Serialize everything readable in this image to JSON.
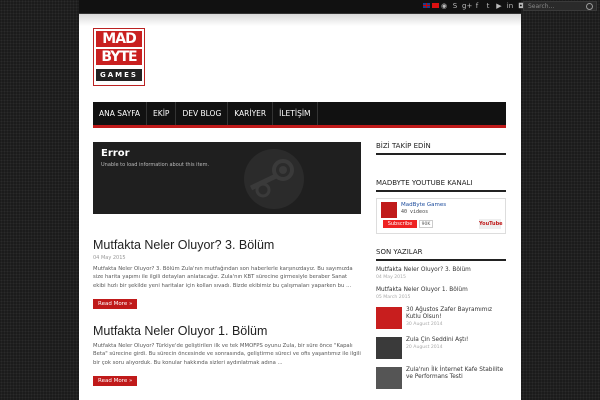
{
  "topbar": {
    "flags": [
      "uk",
      "tr"
    ],
    "social_icons": [
      "rss-icon",
      "skype-icon",
      "google-plus-icon",
      "facebook-icon",
      "twitter-icon",
      "youtube-icon",
      "linkedin-icon",
      "instagram-icon",
      "email-icon"
    ],
    "search_placeholder": "Search..."
  },
  "logo": {
    "line1": "MAD",
    "line2": "BYTE",
    "line3": "GAMES"
  },
  "nav": [
    "ANA SAYFA",
    "EKİP",
    "DEV BLOG",
    "KARİYER",
    "İLETİŞİM"
  ],
  "steam_widget": {
    "title": "Error",
    "message": "Unable to load information about this item."
  },
  "posts": [
    {
      "title": "Mutfakta Neler Oluyor? 3. Bölüm",
      "date": "04 May 2015",
      "excerpt": "Mutfakta Neler Oluyor? 3. Bölüm Zula'nın mutfağından son haberlerle karşınızdayız. Bu sayımızda size harita yapımı ile ilgili detayları anlatacağız. Zula'nın KBT sürecine girmesiyle beraber Sanat ekibi hızlı bir şekilde yeni haritalar için kollan sıvadı. Bizde ekibimiz bu çalışmaları yaparken bu ...",
      "more": "Read More »"
    },
    {
      "title": "Mutfakta Neler Oluyor 1. Bölüm",
      "date": "",
      "excerpt": "Mutfakta Neler Oluyor? Türkiye'de geliştirilen ilk ve tek MMOFPS oyunu Zula, bir süre önce \"Kapalı Beta\" sürecine girdi. Bu sürecin öncesinde ve sonrasında, geliştirme süreci ve ofis yaşantımız ile ilgili bir çok soru alıyorduk. Bu konular hakkında sizleri aydınlatmak adına ...",
      "more": "Read More »"
    }
  ],
  "sidebar": {
    "follow_title": "BİZİ TAKİP EDİN",
    "youtube_title": "MADBYTE YOUTUBE KANALI",
    "youtube": {
      "name": "MadByte Games",
      "videos": "40 videos",
      "subscribe": "Subscribe",
      "sub_count": "90K",
      "brand": "YouTube"
    },
    "recent_title": "SON YAZILAR",
    "recent": [
      {
        "title": "Mutfakta Neler Oluyor? 3. Bölüm",
        "date": "04 May 2015",
        "thumb": false
      },
      {
        "title": "Mutfakta Neler Oluyor 1. Bölüm",
        "date": "05 March 2015",
        "thumb": false
      },
      {
        "title": "30 Ağustos Zafer Bayramımız Kutlu Olsun!",
        "date": "30 August 2014",
        "thumb": true
      },
      {
        "title": "Zula Çin Seddini Aştı!",
        "date": "20 August 2014",
        "thumb": true
      },
      {
        "title": "Zula'nın İlk İnternet Kafe Stabilite ve Performans Testi",
        "date": "",
        "thumb": true
      }
    ]
  },
  "colors": {
    "accent": "#c01a1a",
    "nav_bg": "#111111"
  }
}
